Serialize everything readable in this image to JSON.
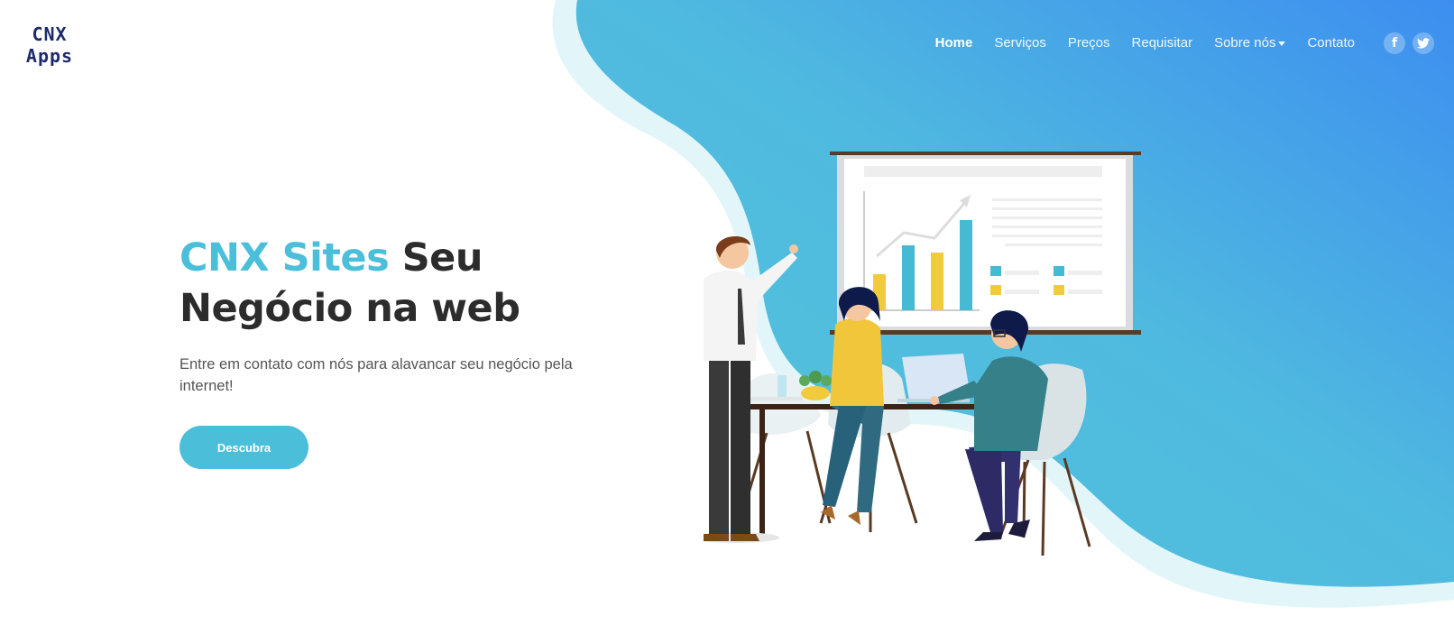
{
  "logo": {
    "line1": "CNX",
    "line2": "Apps"
  },
  "nav": {
    "items": [
      {
        "label": "Home",
        "active": true
      },
      {
        "label": "Serviços"
      },
      {
        "label": "Preços"
      },
      {
        "label": "Requisitar"
      },
      {
        "label": "Sobre nós",
        "dropdown": true
      },
      {
        "label": "Contato"
      }
    ],
    "social": [
      {
        "name": "facebook-icon",
        "glyph": "f"
      },
      {
        "name": "twitter-icon",
        "glyph": "t"
      }
    ]
  },
  "hero": {
    "title_accent": "CNX Sites",
    "title_rest": "Seu Negócio na web",
    "description": "Entre em contato com nós para alavancar seu negócio pela internet!",
    "cta_label": "Descubra"
  },
  "colors": {
    "accent": "#4bbfda",
    "gradient_start": "#55c6da",
    "gradient_end": "#3d8ef0",
    "dark_text": "#2c2c2c",
    "logo": "#1d2b6b"
  }
}
